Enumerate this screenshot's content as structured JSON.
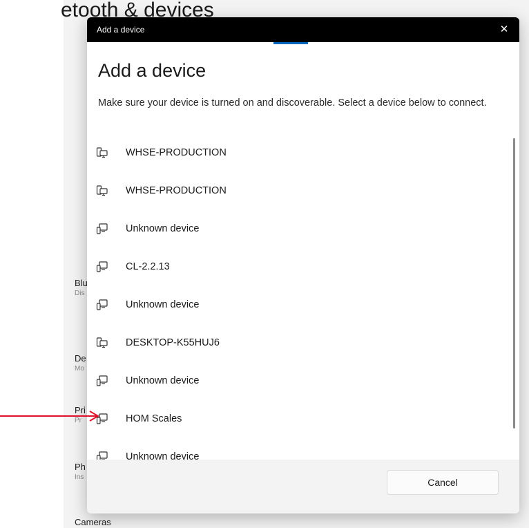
{
  "background": {
    "title": "etooth & devices",
    "items": [
      {
        "label": "Blu",
        "sub": "Dis"
      },
      {
        "label": "De",
        "sub": "Mo"
      },
      {
        "label": "Pri",
        "sub": "Pr"
      },
      {
        "label": "Ph",
        "sub": "Ins"
      },
      {
        "label": "Cameras",
        "sub": ""
      }
    ]
  },
  "dialog": {
    "window_title": "Add a device",
    "close_icon": "close-icon",
    "heading": "Add a device",
    "description": "Make sure your device is turned on and discoverable. Select a device below to connect.",
    "devices": [
      {
        "name": "WHSE-PRODUCTION",
        "icon": "computer-icon"
      },
      {
        "name": "WHSE-PRODUCTION",
        "icon": "computer-icon"
      },
      {
        "name": "Unknown device",
        "icon": "device-icon"
      },
      {
        "name": "CL-2.2.13",
        "icon": "device-icon"
      },
      {
        "name": "Unknown device",
        "icon": "device-icon"
      },
      {
        "name": "DESKTOP-K55HUJ6",
        "icon": "computer-icon"
      },
      {
        "name": "Unknown device",
        "icon": "device-icon"
      },
      {
        "name": "HOM Scales",
        "icon": "device-icon"
      },
      {
        "name": "Unknown device",
        "icon": "device-icon"
      }
    ],
    "cancel_label": "Cancel"
  },
  "colors": {
    "titlebar": "#000000",
    "accent": "#0067c0",
    "arrow": "#e0102a"
  }
}
